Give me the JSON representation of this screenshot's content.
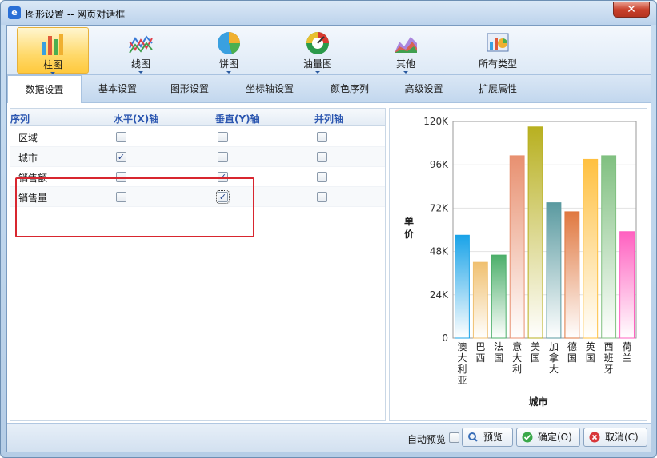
{
  "window": {
    "title": "图形设置 -- 网页对话框",
    "app_icon_glyph": "e",
    "close_glyph": "✕"
  },
  "chart_types": [
    {
      "label": "柱图",
      "icon": "bar-chart-icon",
      "active": true
    },
    {
      "label": "线图",
      "icon": "line-chart-icon",
      "active": false
    },
    {
      "label": "饼图",
      "icon": "pie-chart-icon",
      "active": false
    },
    {
      "label": "油量图",
      "icon": "gauge-chart-icon",
      "active": false
    },
    {
      "label": "其他",
      "icon": "other-chart-icon",
      "active": false
    },
    {
      "label": "所有类型",
      "icon": "all-types-icon",
      "active": false
    }
  ],
  "tabs": [
    {
      "label": "数据设置",
      "active": true
    },
    {
      "label": "基本设置"
    },
    {
      "label": "图形设置"
    },
    {
      "label": "坐标轴设置"
    },
    {
      "label": "颜色序列"
    },
    {
      "label": "高级设置"
    },
    {
      "label": "扩展属性"
    }
  ],
  "grid": {
    "headers": {
      "series": "序列",
      "horizontal": "水平(X)轴",
      "vertical": "垂直(Y)轴",
      "parallel": "并列轴"
    },
    "check_glyph": "✓",
    "rows": [
      {
        "label": "区域",
        "horizontal": false,
        "vertical": false,
        "parallel": false
      },
      {
        "label": "城市",
        "horizontal": true,
        "vertical": false,
        "parallel": false
      },
      {
        "label": "销售额",
        "horizontal": false,
        "vertical": true,
        "parallel": false
      },
      {
        "label": "销售量",
        "horizontal": false,
        "vertical": true,
        "parallel": false
      }
    ]
  },
  "chart_data": {
    "type": "bar",
    "title": "",
    "xlabel": "城市",
    "ylabel": "单价",
    "ylim": [
      0,
      120000
    ],
    "y_ticks": [
      "0",
      "24K",
      "48K",
      "72K",
      "96K",
      "120K"
    ],
    "categories": [
      "澳大利亚",
      "巴西",
      "法国",
      "意大利",
      "美国",
      "加拿大",
      "德国",
      "英国",
      "西班牙",
      "荷兰"
    ],
    "values": [
      57000,
      42000,
      46000,
      101000,
      117000,
      75000,
      70000,
      99000,
      101000,
      59000
    ],
    "colors": [
      "#1aa3e8",
      "#f0c070",
      "#4caf6a",
      "#e89070",
      "#b8b020",
      "#5a9aa0",
      "#e07840",
      "#ffc040",
      "#80c080",
      "#ff60c0"
    ],
    "grid": true,
    "legend": "none"
  },
  "footer": {
    "auto_preview_label": "自动预览",
    "preview_label": "预览",
    "ok_label": "确定(O)",
    "cancel_label": "取消(C)"
  }
}
